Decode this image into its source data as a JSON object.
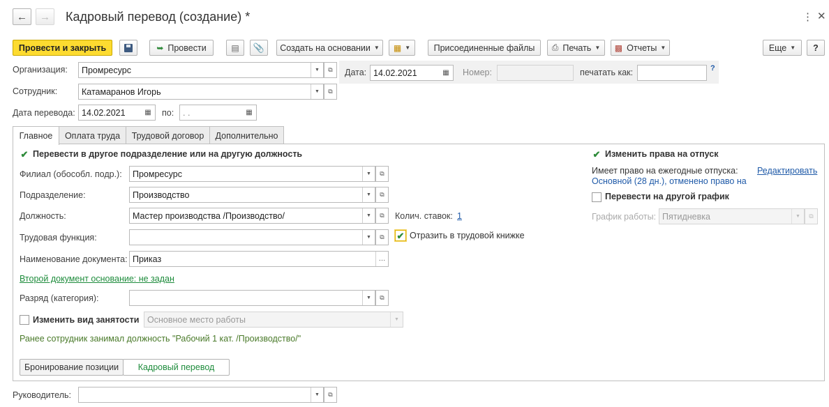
{
  "window": {
    "title": "Кадровый перевод (создание) *",
    "back_icon": "arrow-left-icon",
    "forward_icon": "arrow-right-icon"
  },
  "toolbar": {
    "post_close": "Провести и закрыть",
    "post": "Провести",
    "create_based": "Создать на основании",
    "attached_files": "Присоединенные файлы",
    "print": "Печать",
    "reports": "Отчеты",
    "more": "Еще",
    "help": "?"
  },
  "header": {
    "org_label": "Организация:",
    "org_value": "Промресурс",
    "date_label": "Дата:",
    "date_value": "14.02.2021",
    "number_label": "Номер:",
    "number_value": "",
    "print_as_label": "печатать как:",
    "print_as_value": "",
    "help_mark": "?",
    "employee_label": "Сотрудник:",
    "employee_value": "Катамаранов Игорь",
    "transfer_date_label": "Дата перевода:",
    "transfer_date_value": "14.02.2021",
    "to_label": "по:",
    "to_value": " .  ."
  },
  "tabs": [
    {
      "label": "Главное",
      "active": true
    },
    {
      "label": "Оплата труда",
      "active": false
    },
    {
      "label": "Трудовой договор",
      "active": false
    },
    {
      "label": "Дополнительно",
      "active": false
    }
  ],
  "main": {
    "transfer_checkbox_label": "Перевести в другое подразделение или на другую должность",
    "transfer_checked": true,
    "branch_label": "Филиал (обособл. подр.):",
    "branch_value": "Промресурс",
    "department_label": "Подразделение:",
    "department_value": "Производство",
    "position_label": "Должность:",
    "position_value": "Мастер производства /Производство/",
    "rates_label": "Колич. ставок:",
    "rates_value": "1",
    "labor_function_label": "Трудовая функция:",
    "labor_function_value": "",
    "workbook_label": "Отразить в трудовой книжке",
    "workbook_checked": true,
    "doc_name_label": "Наименование документа:",
    "doc_name_value": "Приказ",
    "second_doc_link": "Второй документ основание: не задан",
    "grade_label": "Разряд (категория):",
    "grade_value": "",
    "employment_checkbox_label": "Изменить вид занятости",
    "employment_checked": false,
    "employment_value": "Основное место работы",
    "previous_position_note": "Ранее сотрудник занимал должность \"Рабочий 1 кат. /Производство/\"",
    "booking_button": "Бронирование позиции",
    "transfer_button": "Кадровый перевод"
  },
  "right": {
    "vacation_checkbox_label": "Изменить права на отпуск",
    "vacation_checked": true,
    "annual_leave_text": "Имеет право на ежегодные отпуска:",
    "edit_link": "Редактировать",
    "leave_details": "Основной (28 дн.), отменено право на",
    "schedule_checkbox_label": "Перевести на другой график",
    "schedule_checked": false,
    "schedule_label": "График работы:",
    "schedule_value": "Пятидневка"
  },
  "footer": {
    "manager_label": "Руководитель:",
    "manager_value": ""
  },
  "colors": {
    "primary_button": "#fddb30",
    "check_green": "#2e8b3a",
    "link_blue": "#1f5aa8",
    "link_green": "#1e8c3c",
    "note_green": "#4a7a2a"
  }
}
